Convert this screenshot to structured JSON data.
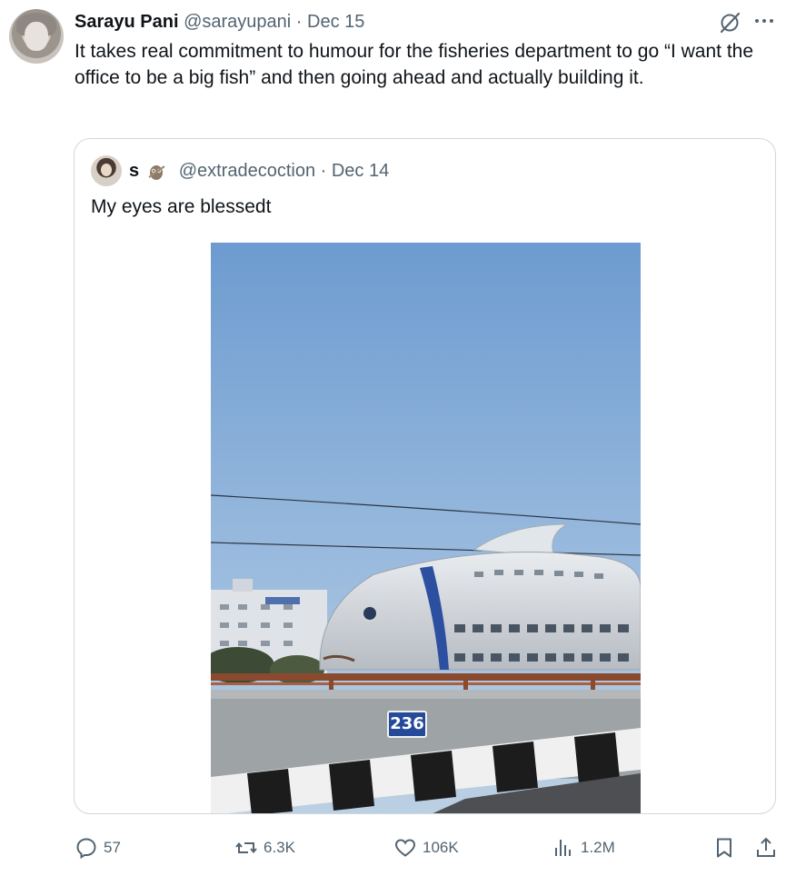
{
  "tweet": {
    "author_name": "Sarayu Pani",
    "handle": "@sarayupani",
    "date": "· Dec 15",
    "text": "It takes real commitment to humour for the fisheries department to go “I want the office to be a big fish” and then going ahead and actually building it."
  },
  "quoted": {
    "author_name": "s",
    "handle": "@extradecoction",
    "date": "· Dec 14",
    "text": "My eyes are blessedt",
    "photo": {
      "sign_number": "236"
    }
  },
  "actions": {
    "replies": "57",
    "reposts": "6.3K",
    "likes": "106K",
    "views": "1.2M"
  },
  "icons": {
    "reply": "speech-bubble-icon",
    "repost": "repost-arrows-icon",
    "like": "heart-icon",
    "views": "bar-chart-icon",
    "bookmark": "bookmark-icon",
    "share": "share-upload-icon",
    "grok": "grok-slash-icon",
    "more": "more-dots-icon"
  },
  "colors": {
    "text": "#0f1419",
    "muted": "#536471",
    "border": "#cfd9de"
  }
}
